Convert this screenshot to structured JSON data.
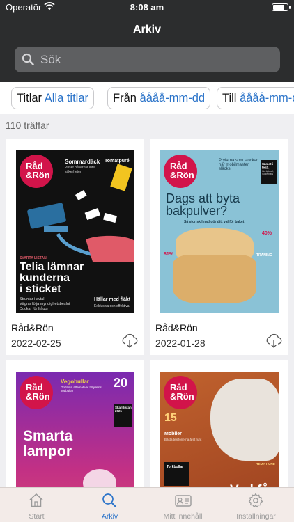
{
  "status_bar": {
    "carrier": "Operatör",
    "time": "8:08 am",
    "battery_level": 0.85
  },
  "header": {
    "title": "Arkiv"
  },
  "search": {
    "placeholder": "Sök"
  },
  "filters": [
    {
      "label": "Titlar",
      "value": "Alla titlar"
    },
    {
      "label": "Från",
      "value": "åååå-mm-dd"
    },
    {
      "label": "Till",
      "value": "åååå-mm-dd"
    }
  ],
  "results": {
    "count_text": "110 träffar"
  },
  "issues": [
    {
      "title": "Råd&Rön",
      "date": "2022-02-25",
      "cover": {
        "logo": "Råd & Rön",
        "headline1": "Telia lämnar",
        "headline2": "kunderna",
        "headline3": "i sticket",
        "kicker": "SVARTA LISTAN",
        "teaser1": "Sommardäck",
        "teaser1_sub": "Priset påverkar inte säkerheten",
        "teaser2": "Tomatpuré",
        "bullets": [
          "Struntar i avtal",
          "Vägrar följa myndighetsbeslut",
          "Duckar för frågor"
        ],
        "footer_title": "Hällar med fläkt",
        "footer_sub": "Exklusiva och effektiva",
        "colors": {
          "bg": "#111111",
          "accent": "#d2144a",
          "hand": "#e05a68",
          "item": "#2a6fa0"
        }
      }
    },
    {
      "title": "Råd&Rön",
      "date": "2022-01-28",
      "cover": {
        "logo": "Råd & Rön",
        "headline1": "Dags att byta",
        "headline2": "bakpulver?",
        "subline": "Så stor skillnad gör ditt val för baket",
        "teaser1": "Prylarna som slockar när mobilmasten släcks",
        "box_title": "Sämst i test",
        "box_text": "Elfläkt, Hurtigkraft, Söderbärs",
        "side_pct1": "40%",
        "side_pct2": "81%",
        "side_label": "TRÄNING",
        "colors": {
          "bg": "#8ac2d6",
          "accent": "#d2144a",
          "bread": "#e8c58a"
        }
      }
    },
    {
      "title": "",
      "date": "",
      "cover": {
        "logo": "Råd & Rön",
        "teaser1": "Vegobullar",
        "teaser1_sub": "Godaste alternativet till julens köttbullar",
        "big_number": "20",
        "headline1": "Smarta",
        "headline2": "lampor",
        "box_title": "Skamlistan 2021",
        "colors": {
          "bg": "#b0288c",
          "accent": "#d2144a"
        }
      }
    },
    {
      "title": "",
      "date": "",
      "cover": {
        "logo": "Råd & Rön",
        "big_number": "15",
        "teaser1": "Mobiler",
        "teaser1_sub": "Bästa telefonerna året runt",
        "box_title": "Torkbollar",
        "headline1": "Vad får",
        "kicker": "TEMA HUND",
        "colors": {
          "bg": "#a8502a",
          "accent": "#d2144a"
        }
      }
    }
  ],
  "tabs": [
    {
      "label": "Start",
      "icon": "house-icon"
    },
    {
      "label": "Arkiv",
      "icon": "search-icon",
      "active": true
    },
    {
      "label": "Mitt innehåll",
      "icon": "id-card-icon"
    },
    {
      "label": "Inställningar",
      "icon": "gear-icon"
    }
  ]
}
